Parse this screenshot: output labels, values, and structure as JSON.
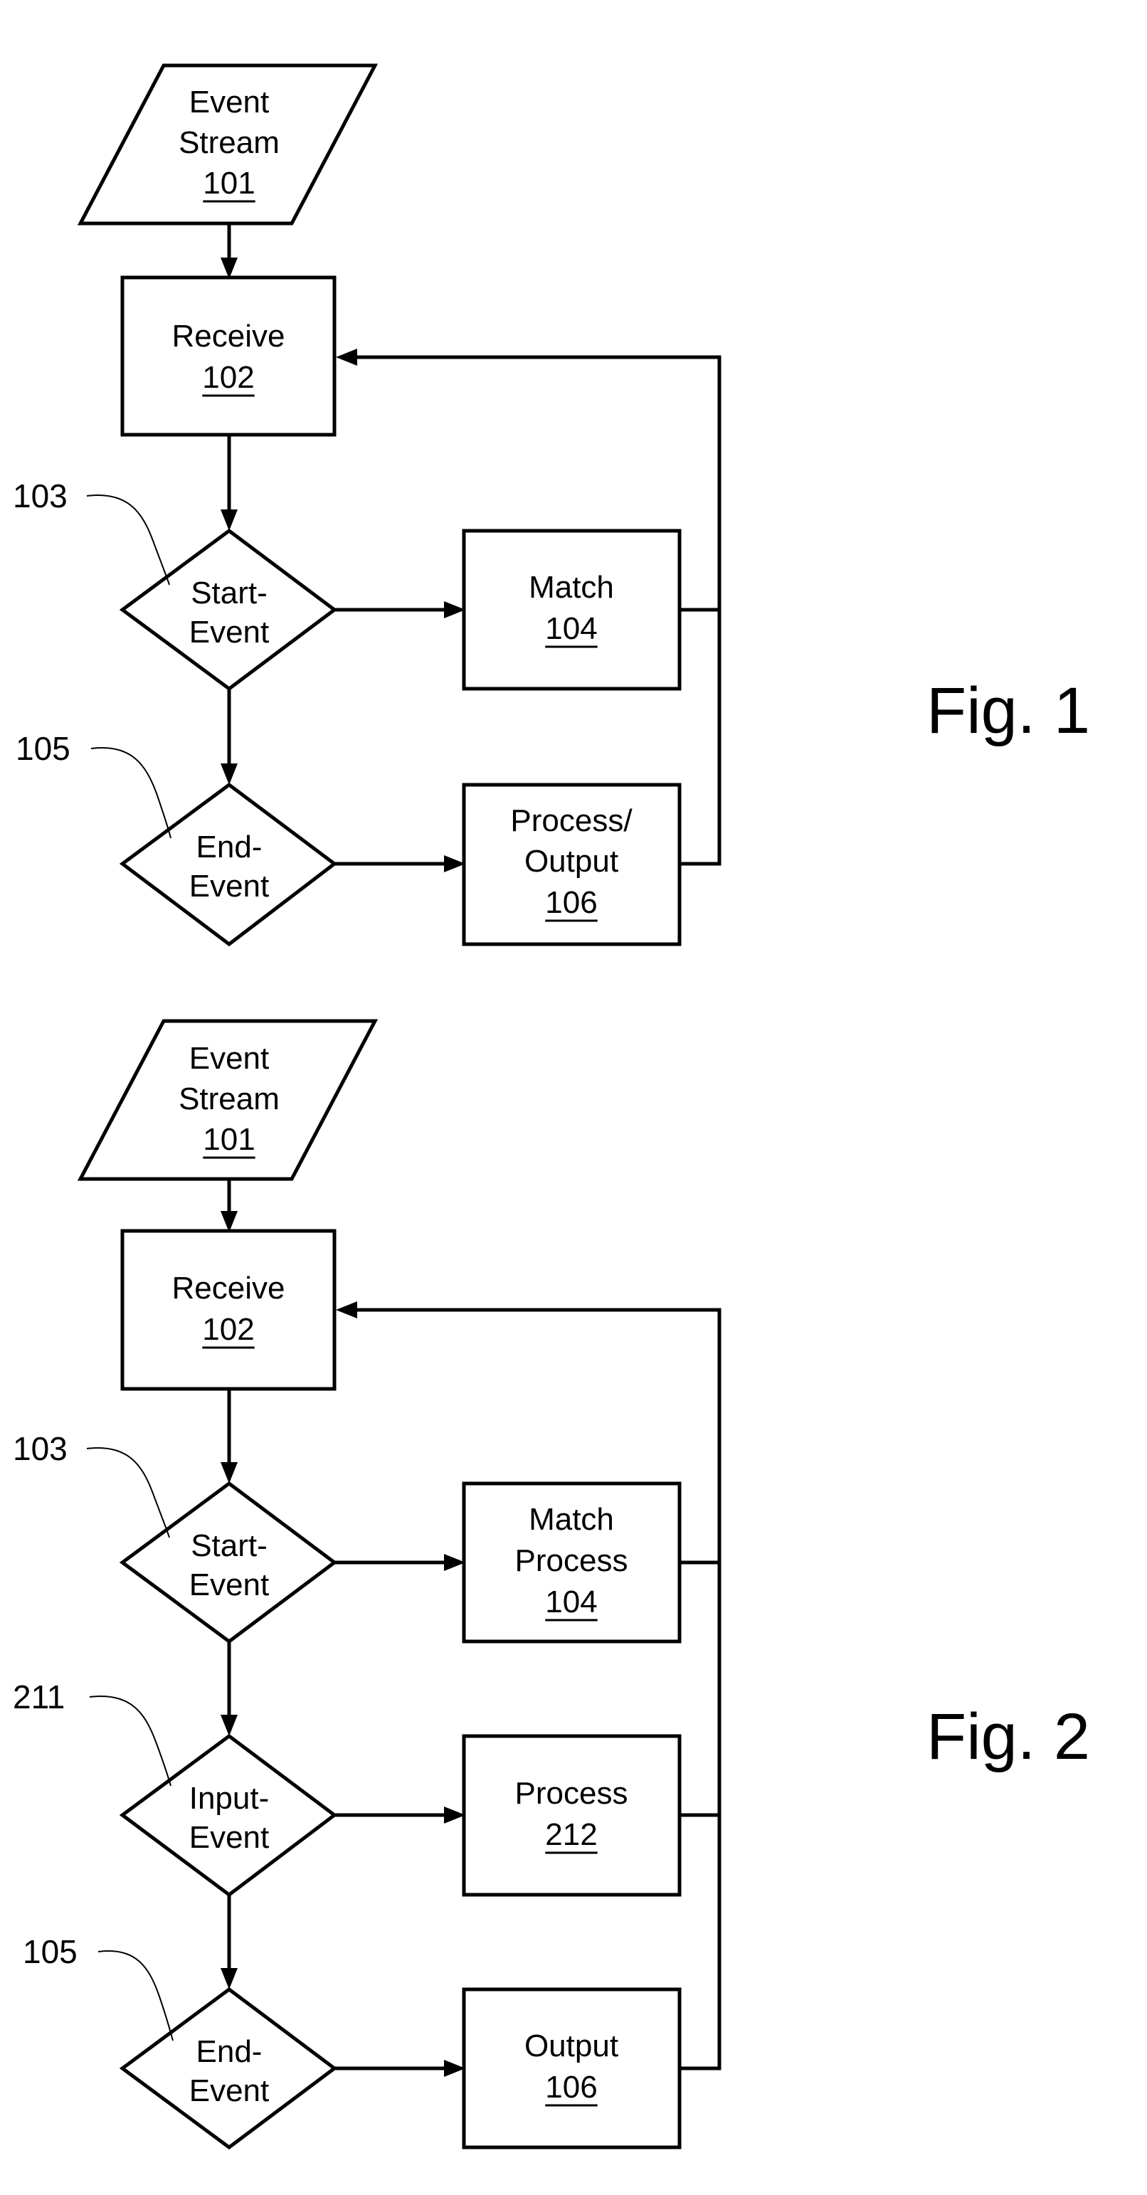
{
  "colors": {
    "stroke": "#000000",
    "background": "#ffffff"
  },
  "figures": [
    {
      "caption": "Fig. 1",
      "nodes": {
        "input": {
          "lines": [
            "Event",
            "Stream"
          ],
          "ref": "101"
        },
        "receive": {
          "lines": [
            "Receive"
          ],
          "ref": "102"
        },
        "start": {
          "lines": [
            "Start-",
            "Event"
          ],
          "callout": "103"
        },
        "match": {
          "lines": [
            "Match"
          ],
          "ref": "104"
        },
        "end": {
          "lines": [
            "End-",
            "Event"
          ],
          "callout": "105"
        },
        "output": {
          "lines": [
            "Process/",
            "Output"
          ],
          "ref": "106"
        }
      }
    },
    {
      "caption": "Fig. 2",
      "nodes": {
        "input": {
          "lines": [
            "Event",
            "Stream"
          ],
          "ref": "101"
        },
        "receive": {
          "lines": [
            "Receive"
          ],
          "ref": "102"
        },
        "start": {
          "lines": [
            "Start-",
            "Event"
          ],
          "callout": "103"
        },
        "match": {
          "lines": [
            "Match",
            "Process"
          ],
          "ref": "104"
        },
        "inputev": {
          "lines": [
            "Input-",
            "Event"
          ],
          "callout": "211"
        },
        "process": {
          "lines": [
            "Process"
          ],
          "ref": "212"
        },
        "end": {
          "lines": [
            "End-",
            "Event"
          ],
          "callout": "105"
        },
        "output": {
          "lines": [
            "Output"
          ],
          "ref": "106"
        }
      }
    }
  ]
}
